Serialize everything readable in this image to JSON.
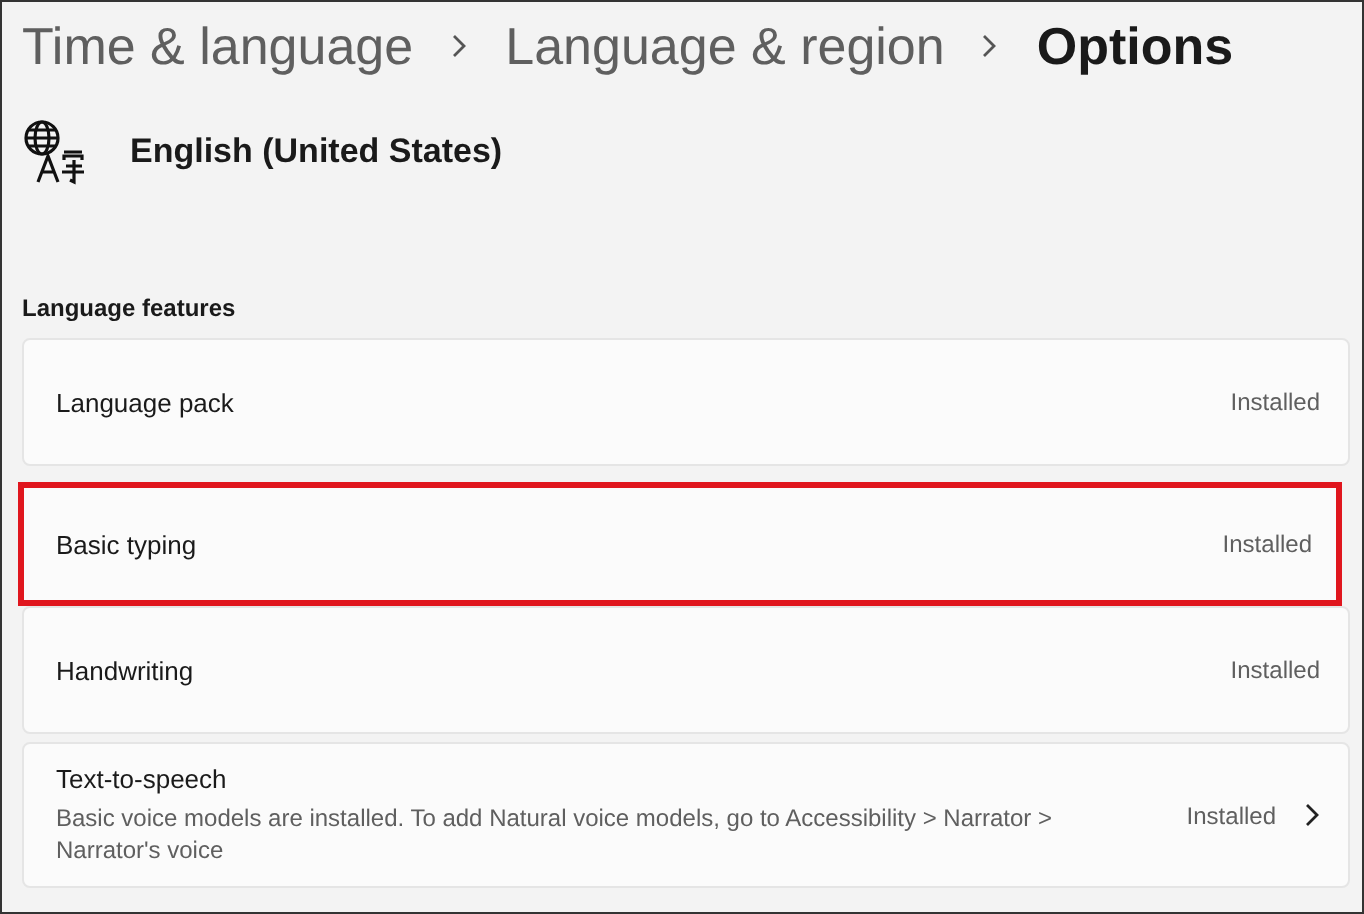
{
  "breadcrumb": [
    {
      "label": "Time & language",
      "current": false
    },
    {
      "label": "Language & region",
      "current": false
    },
    {
      "label": "Options",
      "current": true
    }
  ],
  "language": {
    "name": "English (United States)"
  },
  "section": {
    "title": "Language features"
  },
  "features": [
    {
      "name": "Language pack",
      "status": "Installed",
      "highlighted": false
    },
    {
      "name": "Basic typing",
      "status": "Installed",
      "highlighted": true
    },
    {
      "name": "Handwriting",
      "status": "Installed",
      "highlighted": false
    },
    {
      "name": "Text-to-speech",
      "description": "Basic voice models are installed. To add Natural voice models, go to Accessibility > Narrator > Narrator's voice",
      "status": "Installed",
      "chevron": true,
      "highlighted": false
    }
  ]
}
